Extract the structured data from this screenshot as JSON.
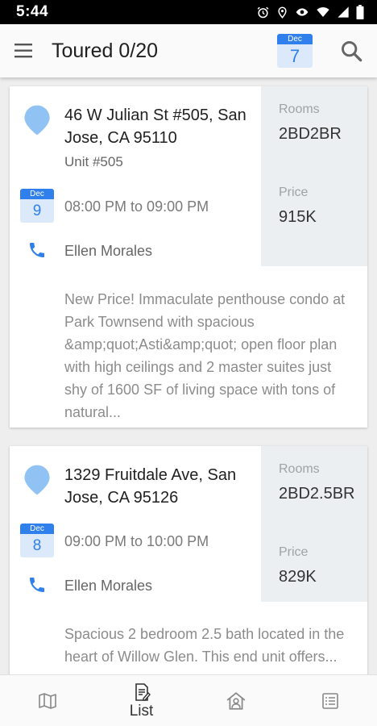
{
  "status_bar": {
    "time": "5:44",
    "icons": [
      "alarm-icon",
      "location-icon",
      "eye-icon",
      "wifi-icon",
      "signal-icon",
      "battery-icon"
    ]
  },
  "app_bar": {
    "title": "Toured 0/20",
    "date_badge": {
      "month": "Dec",
      "day": "7"
    },
    "icons": [
      "menu-icon",
      "calendar-icon",
      "search-icon"
    ]
  },
  "listings": [
    {
      "address": "46 W Julian St #505, San Jose, CA 95110",
      "unit": "Unit  #505",
      "date_month": "Dec",
      "date_day": "9",
      "time": "08:00 PM to 09:00 PM",
      "agent": "Ellen Morales",
      "description": "New Price! Immaculate penthouse condo at Park Townsend with spacious &amp;quot;Asti&amp;quot; open floor plan with high ceilings and 2 master suites just shy of 1600 SF of living space with tons of natural...",
      "rooms_label": "Rooms",
      "rooms": "2BD2BR",
      "price_label": "Price",
      "price": "915K"
    },
    {
      "address": "1329 Fruitdale Ave, San Jose, CA 95126",
      "date_month": "Dec",
      "date_day": "8",
      "time": "09:00 PM to 10:00 PM",
      "agent": "Ellen Morales",
      "description": "Spacious 2 bedroom 2.5 bath located in the heart of Willow Glen. This end unit offers...",
      "rooms_label": "Rooms",
      "rooms": "2BD2.5BR",
      "price_label": "Price",
      "price": "829K"
    }
  ],
  "bottom_nav": [
    {
      "icon": "map-icon",
      "label": ""
    },
    {
      "icon": "list-icon",
      "label": "List"
    },
    {
      "icon": "house-person-icon",
      "label": ""
    },
    {
      "icon": "checklist-icon",
      "label": ""
    }
  ],
  "colors": {
    "accent": "#2f80ed",
    "pin": "#90c2f4",
    "panel": "#eceff2"
  }
}
